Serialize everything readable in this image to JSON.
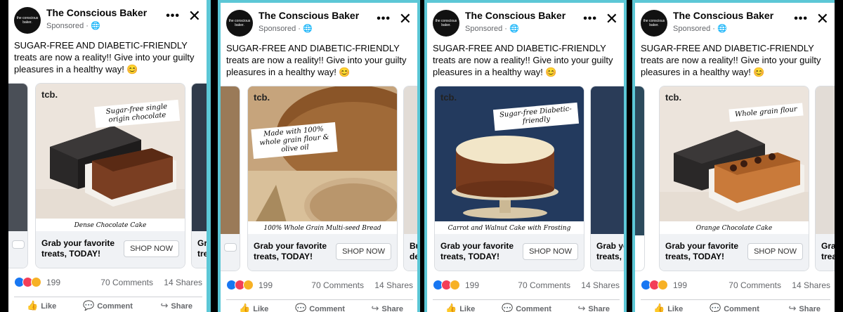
{
  "ads": [
    {
      "page_name": "The Conscious Baker",
      "logo_text": "the conscious baker.",
      "sponsored": "Sponsored · ",
      "body_text": "SUGAR-FREE AND DIABETIC-FRIENDLY treats are now a reality!! Give into your guilty pleasures in a healthy way! 😊",
      "card": {
        "brand": "tcb.",
        "note": "Sugar-free single origin chocolate",
        "caption": "Dense Chocolate Cake",
        "title": "Grab your favorite treats, TODAY!",
        "button": "SHOP NOW"
      },
      "next_card_title": "Gra trea",
      "reactions": "199",
      "comments": "70 Comments",
      "shares": "14 Shares",
      "actions": {
        "like": "Like",
        "comment": "Comment",
        "share": "Share"
      }
    },
    {
      "page_name": "The Conscious Baker",
      "logo_text": "the conscious baker.",
      "sponsored": "Sponsored · ",
      "body_text": "SUGAR-FREE AND DIABETIC-FRIENDLY treats are now a reality!! Give into your guilty pleasures in a healthy way! 😊",
      "card": {
        "brand": "tcb.",
        "note": "Made with 100% whole grain flour & olive oil",
        "caption": "100% Whole Grain Multi-seed Bread",
        "title": "Grab your favorite treats, TODAY!",
        "button": "SHOP NOW"
      },
      "next_card_title": "Buy des",
      "reactions": "199",
      "comments": "70 Comments",
      "shares": "14 Shares",
      "actions": {
        "like": "Like",
        "comment": "Comment",
        "share": "Share"
      }
    },
    {
      "page_name": "The Conscious Baker",
      "logo_text": "the conscious baker.",
      "sponsored": "Sponsored · ",
      "body_text": "SUGAR-FREE AND DIABETIC-FRIENDLY treats are now a reality!! Give into your guilty pleasures in a healthy way! 😊",
      "card": {
        "brand": "tcb.",
        "note": "Sugar-free Diabetic-friendly",
        "caption": "Carrot and Walnut Cake with Frosting",
        "title": "Grab your favorite treats, TODAY!",
        "button": "SHOP NOW"
      },
      "next_card_title": "Grab yo treats, T",
      "reactions": "199",
      "comments": "70 Comments",
      "shares": "14 Shares",
      "actions": {
        "like": "Like",
        "comment": "Comment",
        "share": "Share"
      }
    },
    {
      "page_name": "The Conscious Baker",
      "logo_text": "the conscious baker.",
      "sponsored": "Sponsored · ",
      "body_text": "SUGAR-FREE AND DIABETIC-FRIENDLY treats are now a reality!! Give into your guilty pleasures in a healthy way! 😊",
      "card": {
        "brand": "tcb.",
        "note": "Whole grain flour",
        "caption": "Orange Chocolate Cake",
        "title": "Grab your favorite treats, TODAY!",
        "button": "SHOP NOW"
      },
      "next_card_title": "Gra trea",
      "reactions": "199",
      "comments": "70 Comments",
      "shares": "14 Shares",
      "actions": {
        "like": "Like",
        "comment": "Comment",
        "share": "Share"
      }
    }
  ],
  "colors": {
    "accent_border": "#5cc7d6",
    "fb_blue": "#1877f2",
    "muted_text": "#65676b"
  }
}
